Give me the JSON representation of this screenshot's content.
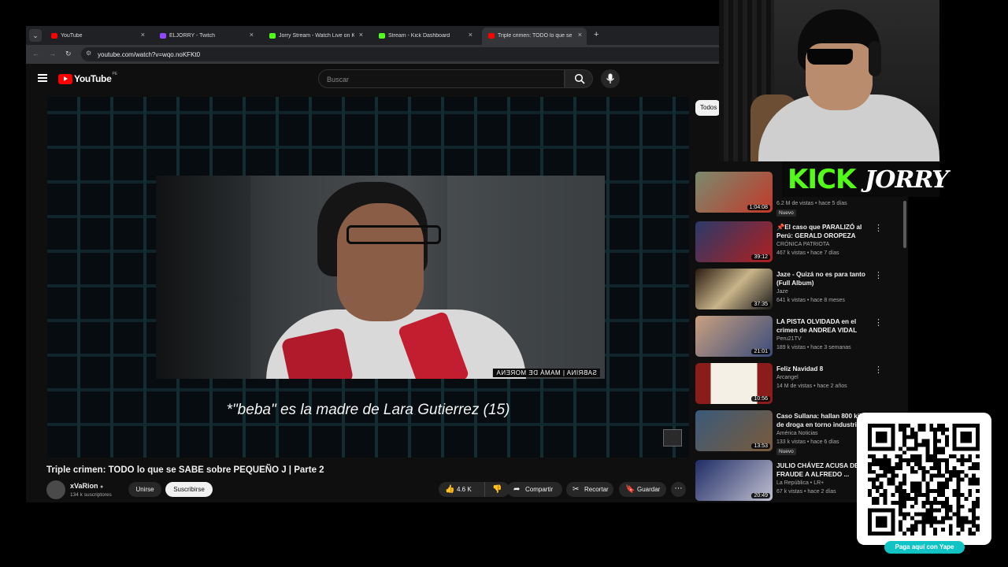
{
  "browser": {
    "tabs": [
      {
        "title": "YouTube",
        "favicon_color": "#ff0000",
        "active": false
      },
      {
        "title": "ELJORRY - Twitch",
        "favicon_color": "#9146ff",
        "active": false
      },
      {
        "title": "Jorry Stream - Watch Live on Ki",
        "favicon_color": "#53fc18",
        "active": false
      },
      {
        "title": "Stream - Kick Dashboard",
        "favicon_color": "#53fc18",
        "active": false
      },
      {
        "title": "Triple crimen: TODO lo que se S",
        "favicon_color": "#ff0000",
        "active": true
      }
    ],
    "url": "youtube.com/watch?v=wqo.noKFKt0",
    "new_tab_icon": "+",
    "tab_close_icon": "×"
  },
  "youtube": {
    "logo_text": "YouTube",
    "country_code": "PE",
    "search_placeholder": "Buscar"
  },
  "video": {
    "subtitle": "*\"beba\" es la madre de Lara Gutierrez (15)",
    "lower_third": "SABRINA | MAMÁ DE MORENA",
    "title": "Triple crimen: TODO lo que se SABE sobre PEQUEÑO J | Parte 2",
    "channel": {
      "name": "xVaRion",
      "subscribers": "134 k suscriptores"
    },
    "join_label": "Unirse",
    "subscribe_label": "Suscribirse",
    "likes": "4.6 K",
    "share_label": "Compartir",
    "clip_label": "Recortar",
    "save_label": "Guardar",
    "more_icon": "⋯"
  },
  "sidebar": {
    "chip_label": "Todos",
    "items": [
      {
        "title": "",
        "channel": "",
        "meta": "6.2 M de vistas • hace 5 días",
        "badge": "Nuevo",
        "duration": "1:04:08",
        "thumb_color": "#7a8a6e"
      },
      {
        "title": "📌El caso que PARALIZÓ al Perú: GERALD OROPEZA",
        "channel": "CRÓNICA PATRIOTA",
        "meta": "467 k vistas • hace 7 días",
        "badge": "",
        "duration": "39:12",
        "thumb_color": "#2a3a6a"
      },
      {
        "title": "Jaze - Quizá no es para tanto (Full Album)",
        "channel": "Jaze",
        "meta": "641 k vistas • hace 8 meses",
        "badge": "",
        "duration": "37:35",
        "thumb_color": "#c9b48a"
      },
      {
        "title": "LA PISTA OLVIDADA en el crimen de ANDREA VIDAL",
        "channel": "Peru21TV",
        "meta": "189 k vistas • hace 3 semanas",
        "badge": "",
        "duration": "21:01",
        "thumb_color": "#3a4c7a"
      },
      {
        "title": "Feliz Navidad 8",
        "channel": "Arcangel",
        "meta": "14 M de vistas • hace 2 años",
        "badge": "",
        "duration": "10:56",
        "thumb_color": "#8a1c1c"
      },
      {
        "title": "Caso Sullana: hallan 800 kilos de droga en torno industrial",
        "channel": "América Noticias",
        "meta": "133 k vistas • hace 6 días",
        "badge": "Nuevo",
        "duration": "13:53",
        "thumb_color": "#3a5a7a"
      },
      {
        "title": "JULIO CHÁVEZ ACUSA DE FRAUDE A ALFREDO ...",
        "channel": "La República • LR+",
        "meta": "67 k vistas • hace 2 días",
        "badge": "",
        "duration": "20:49",
        "thumb_color": "#1f2c66"
      }
    ]
  },
  "overlay": {
    "kick_text": "KICK",
    "streamer_name": "JORRY",
    "qr_caption": "Paga aquí con Yape",
    "kick_color": "#53fc18",
    "yape_color": "#10c4c6"
  }
}
